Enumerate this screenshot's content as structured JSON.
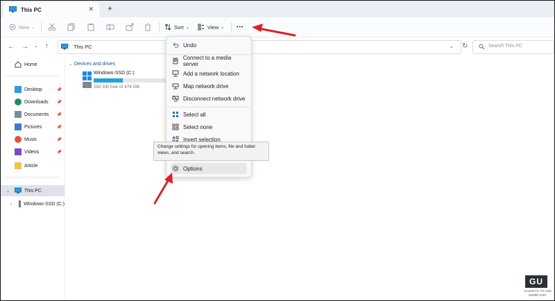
{
  "window": {
    "tab_title": "This PC",
    "tab_close": "✕",
    "new_tab": "+"
  },
  "toolbar": {
    "new_label": "New",
    "sort_label": "Sort",
    "view_label": "View",
    "more_label": "•••"
  },
  "address": {
    "path_item": "This PC",
    "search_placeholder": "Search This PC"
  },
  "nav": {
    "home": "Home",
    "quick": [
      {
        "label": "Desktop",
        "icon": "desktop-icon"
      },
      {
        "label": "Downloads",
        "icon": "downloads-icon"
      },
      {
        "label": "Documents",
        "icon": "documents-icon"
      },
      {
        "label": "Pictures",
        "icon": "pictures-icon"
      },
      {
        "label": "Music",
        "icon": "music-icon"
      },
      {
        "label": "Videos",
        "icon": "videos-icon"
      },
      {
        "label": "Article",
        "icon": "folder-icon"
      }
    ],
    "this_pc": "This PC",
    "drive": "Windows-SSD (C:)"
  },
  "content": {
    "section_title": "Devices and drives",
    "drive_name": "Windows-SSD (C:)",
    "drive_size": "292 GB free of 474 GB",
    "drive_used_fraction": 0.38
  },
  "menu": {
    "items": [
      {
        "label": "Undo",
        "icon": "undo-icon"
      },
      {
        "label": "Connect to a media server",
        "icon": "media-server-icon"
      },
      {
        "label": "Add a network location",
        "icon": "network-location-icon"
      },
      {
        "label": "Map network drive",
        "icon": "map-drive-icon"
      },
      {
        "label": "Disconnect network drive",
        "icon": "disconnect-drive-icon"
      },
      {
        "label": "Select all",
        "icon": "select-all-icon"
      },
      {
        "label": "Select none",
        "icon": "select-none-icon"
      },
      {
        "label": "Invert selection",
        "icon": "invert-selection-icon"
      },
      {
        "label": "Options",
        "icon": "gear-icon"
      }
    ]
  },
  "tooltip": "Change settings for opening items, file and folder views, and search.",
  "watermark": {
    "logo": "GU",
    "line1": "GADGETS TO USE",
    "line2": "wsxdn.com"
  },
  "colors": {
    "accent": "#26a0da",
    "arrow": "#e02020"
  }
}
